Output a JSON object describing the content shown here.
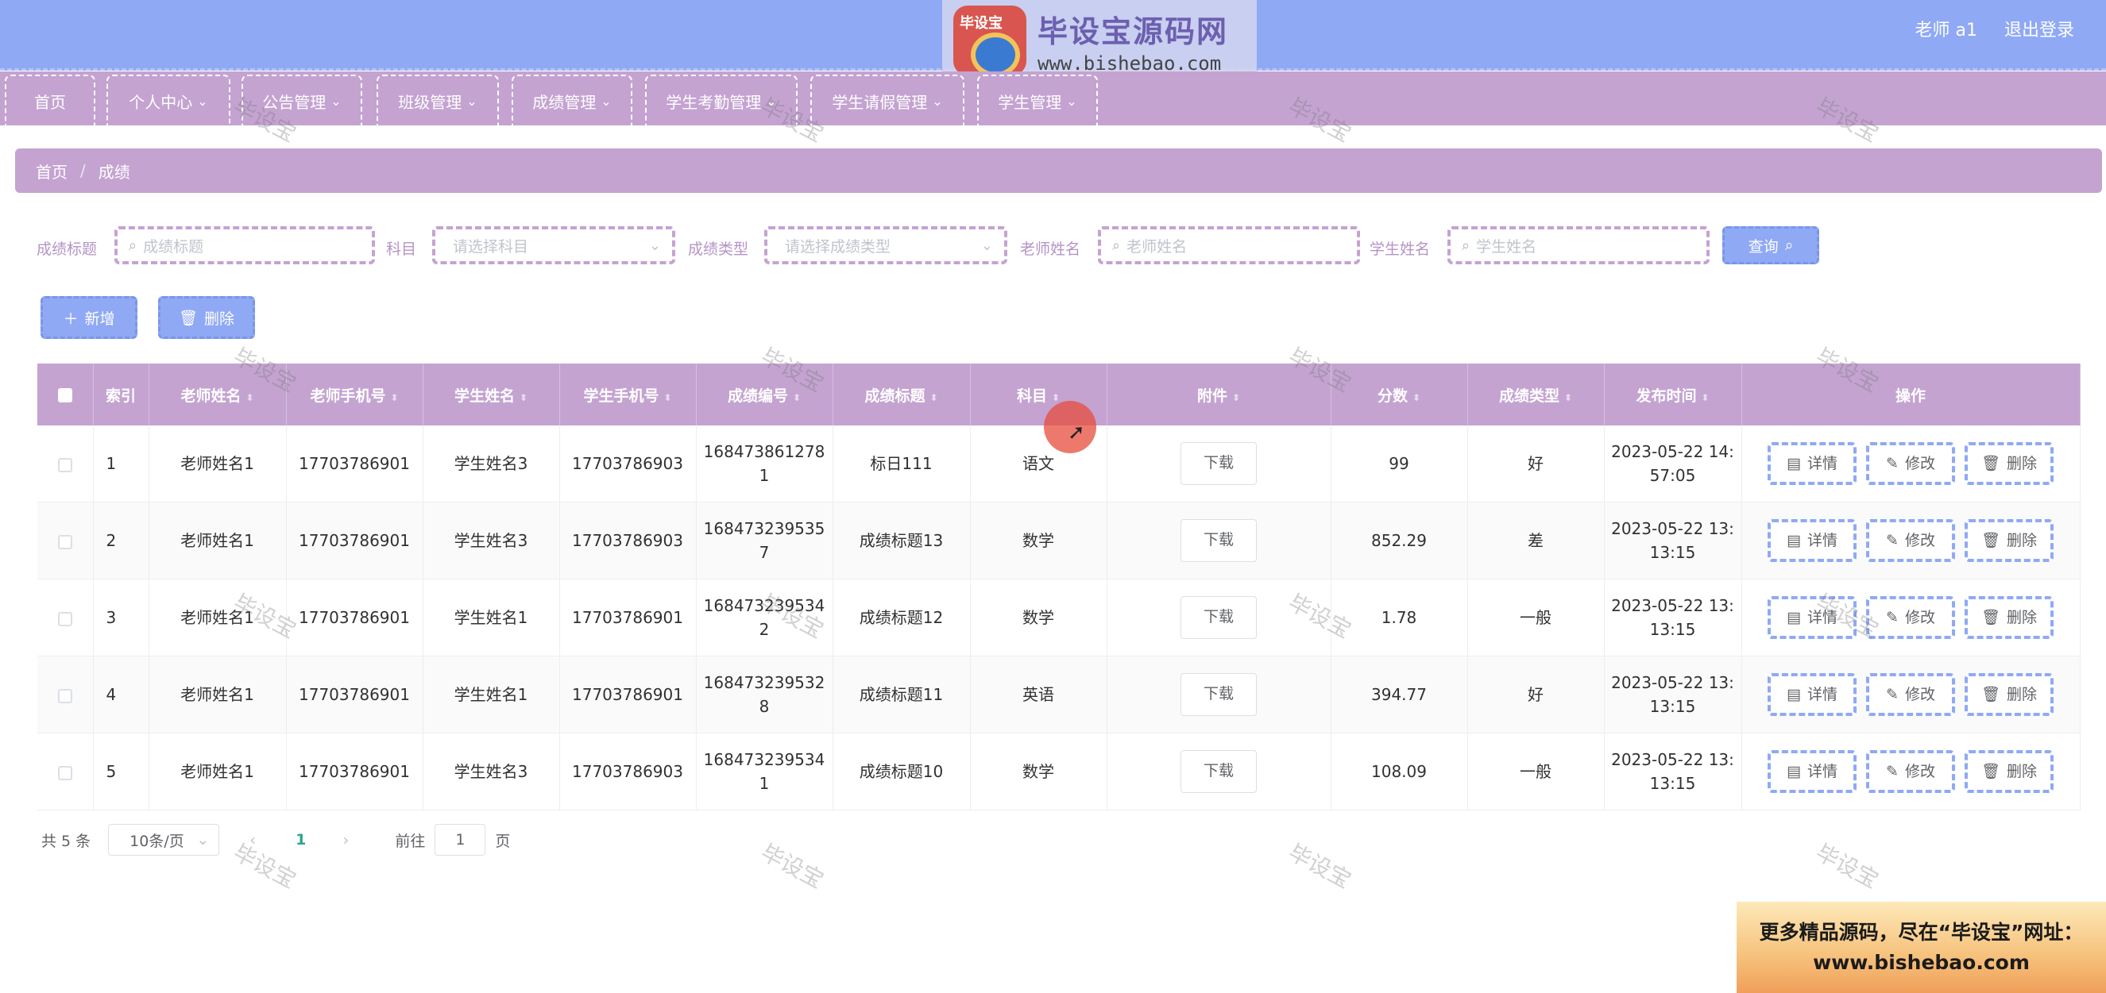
{
  "header": {
    "logo_seal_text": "毕设宝",
    "logo_title": "毕设宝源码网",
    "logo_url": "www.bishebao.com",
    "user": "老师 a1",
    "logout": "退出登录",
    "bar_color": "#8fa9f5"
  },
  "nav": {
    "items": [
      {
        "label": "首页",
        "has_dropdown": false
      },
      {
        "label": "个人中心",
        "has_dropdown": true
      },
      {
        "label": "公告管理",
        "has_dropdown": true
      },
      {
        "label": "班级管理",
        "has_dropdown": true
      },
      {
        "label": "成绩管理",
        "has_dropdown": true
      },
      {
        "label": "学生考勤管理",
        "has_dropdown": true
      },
      {
        "label": "学生请假管理",
        "has_dropdown": true
      },
      {
        "label": "学生管理",
        "has_dropdown": true
      }
    ],
    "accent_color": "#c4a3d1"
  },
  "breadcrumb": {
    "home": "首页",
    "separator": "/",
    "current": "成绩"
  },
  "search": {
    "title_label": "成绩标题",
    "title_placeholder": "成绩标题",
    "subject_label": "科目",
    "subject_placeholder": "请选择科目",
    "type_label": "成绩类型",
    "type_placeholder": "请选择成绩类型",
    "teacher_label": "老师姓名",
    "teacher_placeholder": "老师姓名",
    "student_label": "学生姓名",
    "student_placeholder": "学生姓名",
    "query_button": "查询"
  },
  "actions": {
    "add": "新增",
    "delete": "删除"
  },
  "table": {
    "headers": {
      "index": "索引",
      "teacher_name": "老师姓名",
      "teacher_phone": "老师手机号",
      "student_name": "学生姓名",
      "student_phone": "学生手机号",
      "score_no": "成绩编号",
      "score_title": "成绩标题",
      "subject": "科目",
      "attachment": "附件",
      "score": "分数",
      "score_type": "成绩类型",
      "publish_time": "发布时间",
      "operations": "操作"
    },
    "download_label": "下载",
    "op_detail": "详情",
    "op_edit": "修改",
    "op_delete": "删除",
    "rows": [
      {
        "index": "1",
        "teacher_name": "老师姓名1",
        "teacher_phone": "17703786901",
        "student_name": "学生姓名3",
        "student_phone": "17703786903",
        "score_no": "1684738612781",
        "score_title": "标日111",
        "subject": "语文",
        "score": "99",
        "score_type": "好",
        "publish_time": "2023-05-22 14:57:05"
      },
      {
        "index": "2",
        "teacher_name": "老师姓名1",
        "teacher_phone": "17703786901",
        "student_name": "学生姓名3",
        "student_phone": "17703786903",
        "score_no": "1684732395357",
        "score_title": "成绩标题13",
        "subject": "数学",
        "score": "852.29",
        "score_type": "差",
        "publish_time": "2023-05-22 13:13:15"
      },
      {
        "index": "3",
        "teacher_name": "老师姓名1",
        "teacher_phone": "17703786901",
        "student_name": "学生姓名1",
        "student_phone": "17703786901",
        "score_no": "1684732395342",
        "score_title": "成绩标题12",
        "subject": "数学",
        "score": "1.78",
        "score_type": "一般",
        "publish_time": "2023-05-22 13:13:15"
      },
      {
        "index": "4",
        "teacher_name": "老师姓名1",
        "teacher_phone": "17703786901",
        "student_name": "学生姓名1",
        "student_phone": "17703786901",
        "score_no": "1684732395328",
        "score_title": "成绩标题11",
        "subject": "英语",
        "score": "394.77",
        "score_type": "好",
        "publish_time": "2023-05-22 13:13:15"
      },
      {
        "index": "5",
        "teacher_name": "老师姓名1",
        "teacher_phone": "17703786901",
        "student_name": "学生姓名3",
        "student_phone": "17703786903",
        "score_no": "1684732395341",
        "score_title": "成绩标题10",
        "subject": "数学",
        "score": "108.09",
        "score_type": "一般",
        "publish_time": "2023-05-22 13:13:15"
      }
    ]
  },
  "pagination": {
    "total": "共 5 条",
    "page_size": "10条/页",
    "current_page": "1",
    "goto_label": "前往",
    "goto_value": "1",
    "page_unit": "页"
  },
  "watermark_text": "毕设宝",
  "promo": {
    "line1": "更多精品源码，尽在“毕设宝”网址：",
    "line2": "www.bishebao.com"
  }
}
